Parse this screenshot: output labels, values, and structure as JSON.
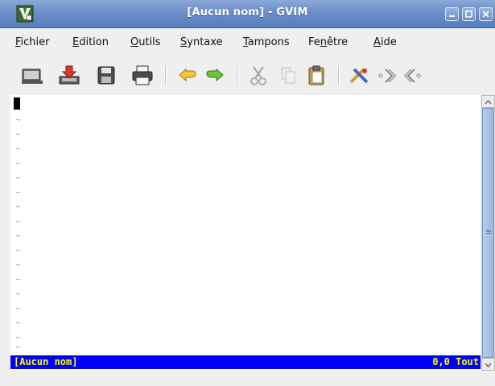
{
  "window": {
    "title": "[Aucun nom] - GVIM",
    "icon": "gvim-app-icon",
    "buttons": [
      "minimize-icon",
      "maximize-icon",
      "close-icon"
    ]
  },
  "menu": {
    "items": [
      {
        "pre": "",
        "ul": "F",
        "post": "ichier"
      },
      {
        "pre": "",
        "ul": "E",
        "post": "dition"
      },
      {
        "pre": "",
        "ul": "O",
        "post": "utils"
      },
      {
        "pre": "",
        "ul": "S",
        "post": "yntaxe"
      },
      {
        "pre": "",
        "ul": "T",
        "post": "ampons"
      },
      {
        "pre": "Fe",
        "ul": "n",
        "post": "être"
      },
      {
        "pre": "",
        "ul": "A",
        "post": "ide"
      }
    ]
  },
  "toolbar": {
    "icons": [
      "open-icon",
      "save-down-icon",
      "save-icon",
      "print-icon",
      "undo-icon",
      "redo-icon",
      "cut-icon",
      "copy-icon",
      "paste-icon",
      "replace-icon",
      "find-next-icon",
      "find-prev-icon"
    ]
  },
  "editor": {
    "empty_line_marker": "~",
    "status_left": "[Aucun nom]",
    "status_right": "0,0 Tout"
  },
  "colors": {
    "statusline_bg": "#0000ff",
    "statusline_fg": "#ffff00",
    "titlebar": "#6b8ec8"
  }
}
